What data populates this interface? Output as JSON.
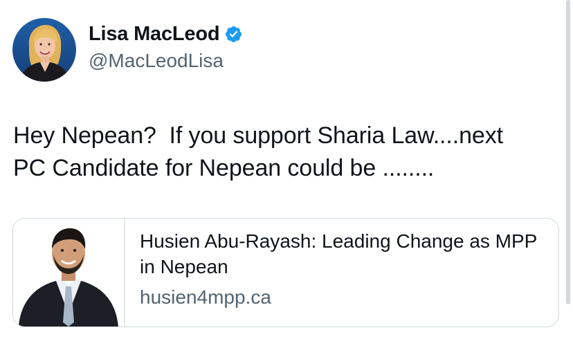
{
  "author": {
    "display_name": "Lisa MacLeod",
    "handle": "@MacLeodLisa",
    "verified": true,
    "avatar_icon": "profile-photo-woman-blonde",
    "verified_color": "#1d9bf0"
  },
  "tweet": {
    "lines": [
      "Hey Nepean?  If you support Sharia Law....next",
      "PC Candidate for Nepean could be ........"
    ]
  },
  "link_card": {
    "thumbnail_icon": "profile-photo-man-suit",
    "title": "Husien Abu-Rayash: Leading Change as MPP in Nepean",
    "domain": "husien4mpp.ca"
  },
  "colors": {
    "text_primary": "#0f1419",
    "text_secondary": "#536471",
    "border": "#cfd9de",
    "background": "#ffffff"
  }
}
